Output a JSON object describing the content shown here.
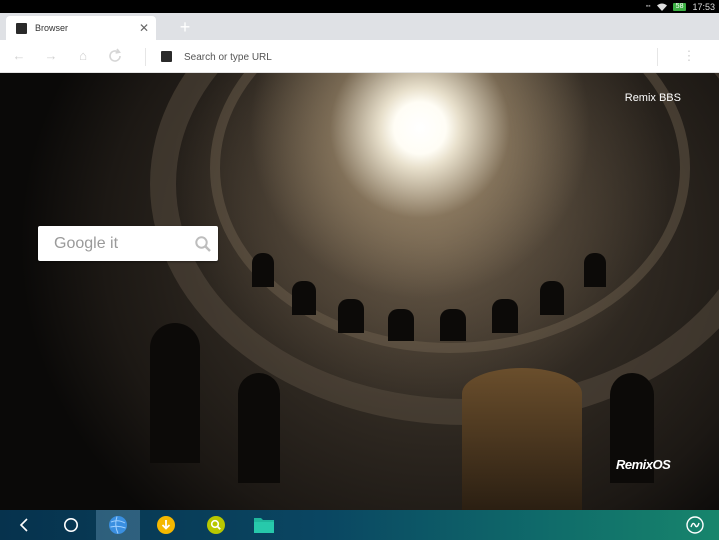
{
  "status_bar": {
    "time": "17:53",
    "battery": "58"
  },
  "tab": {
    "title": "Browser"
  },
  "toolbar": {
    "url_placeholder": "Search or type URL"
  },
  "homepage": {
    "link_label": "Remix BBS",
    "search_placeholder": "Google it",
    "brand_logo": "RemixOS"
  },
  "taskbar": {
    "icons": [
      "back-icon",
      "home-icon",
      "browser-icon",
      "downloader-icon",
      "search-app-icon",
      "file-manager-icon",
      "remix-start-icon"
    ]
  },
  "colors": {
    "battery": "#3cb043",
    "taskbar_start": "#06324d",
    "taskbar_end": "#17856c",
    "downloader": "#f5b800",
    "search_app": "#b8c800",
    "file_manager": "#1fb79c"
  }
}
